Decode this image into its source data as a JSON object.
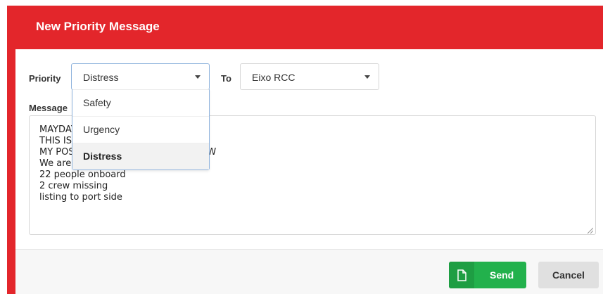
{
  "dialog": {
    "title": "New Priority Message",
    "accent_color": "#e3262b"
  },
  "form": {
    "priority_label": "Priority",
    "priority_value": "Distress",
    "to_label": "To",
    "to_value": "Eixo RCC",
    "message_label": "Message",
    "message_value": "MAYDAY MAYDAY MAYDAY\nTHIS IS\nMY POSITION 51 Deg 0N 002 Deg 00W\nWe are on fire and sinking\n22 people onboard\n2 crew missing\nlisting to port side"
  },
  "priority_dropdown": {
    "options": [
      "Safety",
      "Urgency",
      "Distress"
    ],
    "selected": "Distress"
  },
  "footer": {
    "send_label": "Send",
    "send_icon": "document-icon",
    "send_color": "#22b14c",
    "cancel_label": "Cancel"
  }
}
